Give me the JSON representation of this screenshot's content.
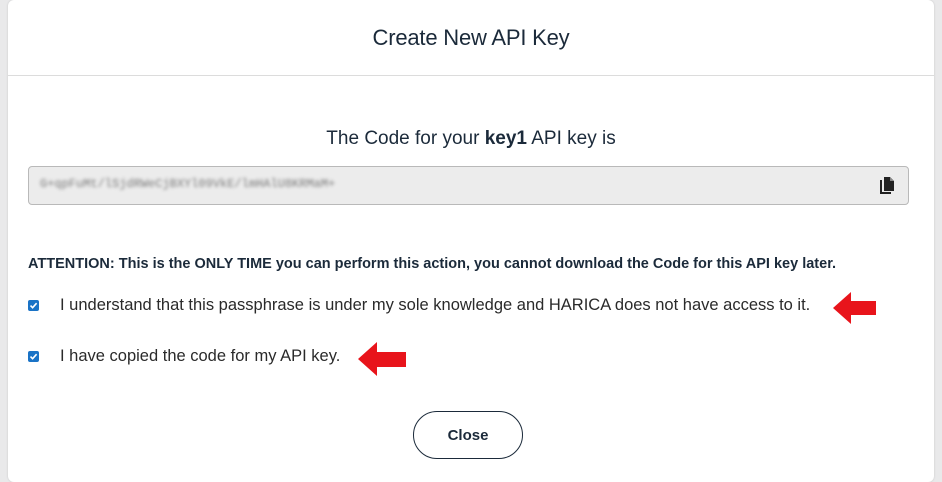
{
  "dialog": {
    "title": "Create New API Key",
    "key_line": {
      "prefix": "The Code for your ",
      "key_name": "key1",
      "suffix": " API key is"
    },
    "code_value": "G+qpFuMt/lSjdRWeCjBXYl09VkE/lmHAlU8KRMaM+",
    "attention": "ATTENTION: This is the ONLY TIME you can perform this action, you cannot download the Code for this API key later.",
    "checkboxes": [
      {
        "label": "I understand that this passphrase is under my sole knowledge and HARICA does not have access to it.",
        "checked": true
      },
      {
        "label": "I have copied the code for my API key.",
        "checked": true
      }
    ],
    "close_label": "Close"
  },
  "icons": {
    "copy": "copy-icon",
    "annotation_arrow": "red-arrow-icon"
  },
  "colors": {
    "title_text": "#1b2a3a",
    "checkbox": "#1a73c6",
    "arrow": "#e8141b",
    "code_box_bg": "#ececec"
  }
}
